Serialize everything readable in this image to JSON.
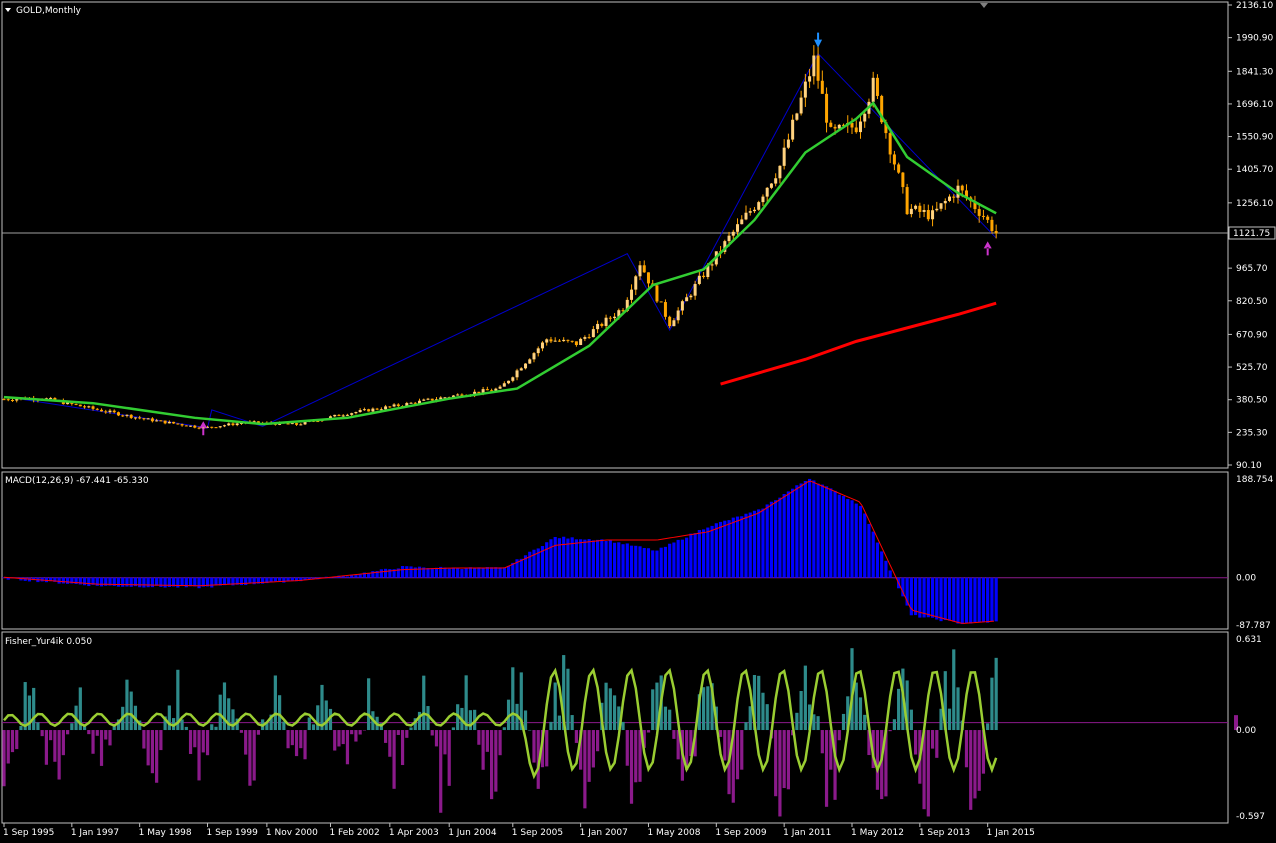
{
  "window": {
    "title": "GOLD,Monthly",
    "price_marker": "1121.75"
  },
  "panels": {
    "price": {
      "y_ticks": [
        "2136.10",
        "1990.90",
        "1841.30",
        "1696.10",
        "1550.90",
        "1405.70",
        "1256.10",
        "1121.75",
        "965.70",
        "820.50",
        "670.90",
        "525.70",
        "380.50",
        "235.30",
        "90.10"
      ]
    },
    "macd": {
      "label": "MACD(12,26,9) -67.441 -65.330",
      "y_ticks": [
        "188.754",
        "0.00",
        "-87.787"
      ]
    },
    "fisher": {
      "label": "Fisher_Yur4ik 0.050",
      "y_ticks": [
        "0.631",
        "0.00",
        "-0.597"
      ]
    }
  },
  "x_ticks": [
    "1 Sep 1995",
    "1 Jan 1997",
    "1 May 1998",
    "1 Sep 1999",
    "1 Nov 2000",
    "1 Feb 2002",
    "1 Apr 2003",
    "1 Jun 2004",
    "1 Sep 2005",
    "1 Jan 2007",
    "1 May 2008",
    "1 Sep 2009",
    "1 Jan 2011",
    "1 May 2012",
    "1 Sep 2013",
    "1 Jan 2015"
  ],
  "colors": {
    "background": "#000000",
    "candle": "#FFA500",
    "ma_fast": "#32CD32",
    "ma_slow": "#FF0000",
    "zigzag": "#0000CD",
    "macd_hist": "#0000FF",
    "macd_signal": "#FF0000",
    "fisher_pos": "#2E8B8B",
    "fisher_neg": "#8B1A8B",
    "fisher_line": "#9ACD32",
    "arrow_down": "#1E90FF",
    "arrow_up": "#CC33CC"
  },
  "chart_data": [
    {
      "type": "candlestick",
      "title": "GOLD,Monthly",
      "ylim": [
        90.1,
        2136.1
      ],
      "x_range": [
        "1995-09",
        "2015-04"
      ],
      "series": [
        {
          "name": "close_approx",
          "x": [
            "1995-09",
            "1996-06",
            "1997-06",
            "1998-06",
            "1999-08",
            "2000-06",
            "2001-06",
            "2002-06",
            "2003-06",
            "2004-06",
            "2005-06",
            "2006-05",
            "2006-12",
            "2007-11",
            "2008-03",
            "2008-10",
            "2009-06",
            "2009-12",
            "2010-06",
            "2010-12",
            "2011-08",
            "2011-12",
            "2012-06",
            "2012-10",
            "2013-06",
            "2013-12",
            "2014-06",
            "2014-12",
            "2015-03"
          ],
          "values": [
            383,
            388,
            340,
            295,
            255,
            280,
            270,
            320,
            355,
            395,
            430,
            650,
            630,
            790,
            990,
            720,
            940,
            1100,
            1245,
            1420,
            1890,
            1560,
            1600,
            1780,
            1230,
            1200,
            1320,
            1200,
            1121.75
          ]
        }
      ]
    },
    {
      "type": "bar",
      "title": "MACD(12,26,9) -67.441 -65.330",
      "ylim": [
        -87.787,
        188.754
      ],
      "series": [
        {
          "name": "histogram",
          "x": [
            "1995",
            "1997",
            "1999",
            "2001",
            "2002",
            "2003",
            "2004",
            "2005",
            "2006",
            "2007",
            "2008",
            "2009",
            "2010",
            "2011",
            "2012",
            "2013",
            "2014",
            "2015"
          ],
          "values": [
            0,
            -15,
            -18,
            -5,
            5,
            20,
            18,
            18,
            75,
            70,
            50,
            95,
            125,
            185,
            135,
            -70,
            -85,
            -80
          ]
        },
        {
          "name": "signal",
          "x": [
            "1995",
            "1997",
            "1999",
            "2001",
            "2002",
            "2003",
            "2004",
            "2005",
            "2006",
            "2007",
            "2008",
            "2009",
            "2010",
            "2011",
            "2012",
            "2013",
            "2014",
            "2015"
          ],
          "values": [
            2,
            -12,
            -15,
            -5,
            5,
            15,
            18,
            18,
            60,
            70,
            70,
            85,
            120,
            180,
            140,
            -60,
            -85,
            -78
          ]
        }
      ]
    },
    {
      "type": "bar",
      "title": "Fisher_Yur4ik 0.050",
      "ylim": [
        -0.597,
        0.631
      ]
    }
  ]
}
